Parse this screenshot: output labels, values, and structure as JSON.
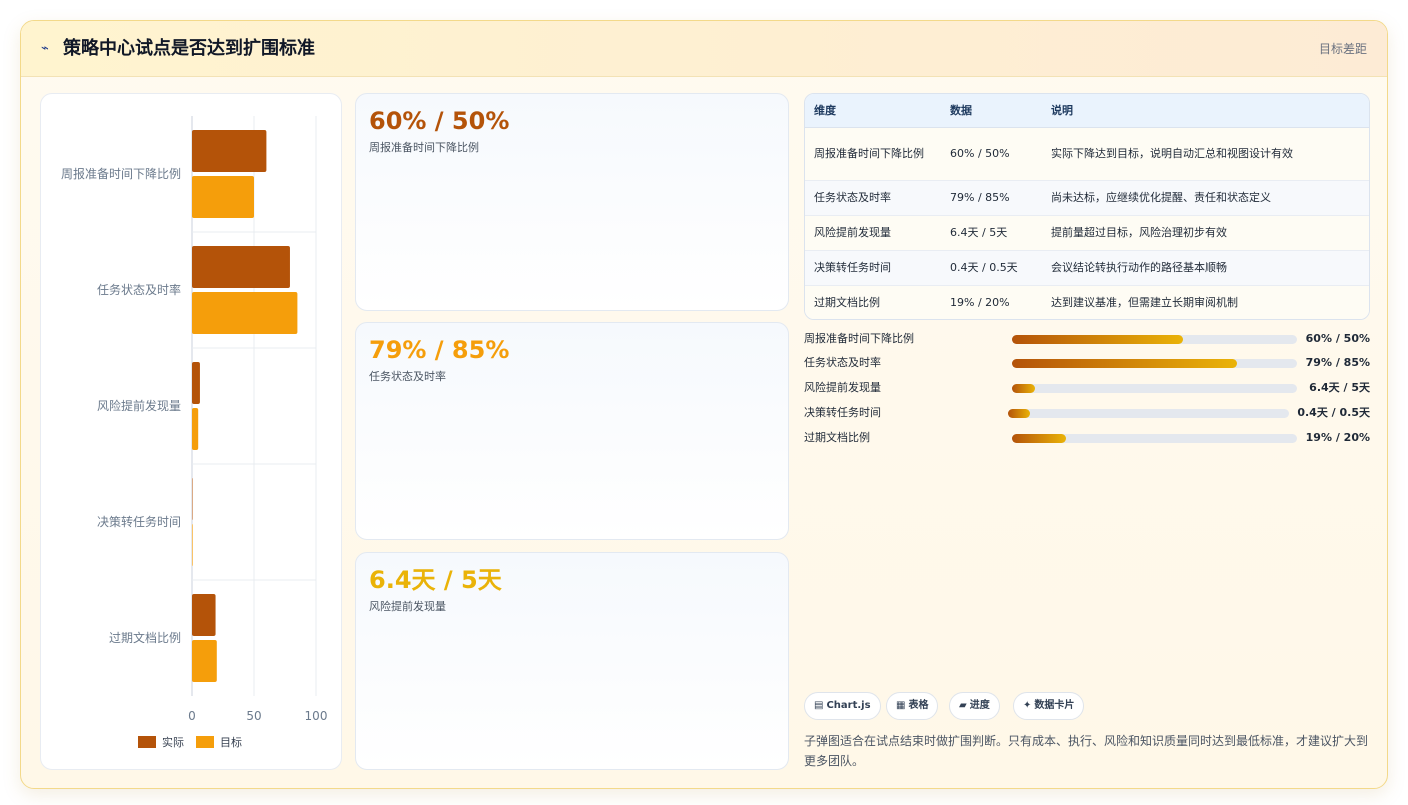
{
  "header": {
    "icon": "chart-line-icon",
    "title": "策略中心试点是否达到扩围标准",
    "badge": "目标差距"
  },
  "chart_data": {
    "type": "bar",
    "orientation": "horizontal",
    "categories": [
      "周报准备时间下降比例",
      "任务状态及时率",
      "风险提前发现量",
      "决策转任务时间",
      "过期文档比例"
    ],
    "series": [
      {
        "name": "实际",
        "values": [
          60,
          79,
          6.4,
          0.4,
          19
        ],
        "color": "#b45309"
      },
      {
        "name": "目标",
        "values": [
          50,
          85,
          5,
          0.5,
          20
        ],
        "color": "#f59e0b"
      }
    ],
    "xlim": [
      0,
      100
    ],
    "xticks": [
      "0",
      "50",
      "100"
    ],
    "grid": true,
    "legend": "bottom"
  },
  "kpis": [
    {
      "value": "60% / 50%",
      "label": "周报准备时间下降比例",
      "color": "#b45309"
    },
    {
      "value": "79% / 85%",
      "label": "任务状态及时率",
      "color": "#f59e0b"
    },
    {
      "value": "6.4天 / 5天",
      "label": "风险提前发现量",
      "color": "#eab308"
    }
  ],
  "table": {
    "headers": [
      "维度",
      "数据",
      "说明"
    ],
    "rows": [
      [
        "周报准备时间下降比例",
        "60% / 50%",
        "实际下降达到目标，说明自动汇总和视图设计有效"
      ],
      [
        "任务状态及时率",
        "79% / 85%",
        "尚未达标，应继续优化提醒、责任和状态定义"
      ],
      [
        "风险提前发现量",
        "6.4天 / 5天",
        "提前量超过目标，风险治理初步有效"
      ],
      [
        "决策转任务时间",
        "0.4天 / 0.5天",
        "会议结论转执行动作的路径基本顺畅"
      ],
      [
        "过期文档比例",
        "19% / 20%",
        "达到建议基准，但需建立长期审阅机制"
      ]
    ]
  },
  "progress": [
    {
      "label": "周报准备时间下降比例",
      "value": "60% / 50%",
      "fill": 0.6
    },
    {
      "label": "任务状态及时率",
      "value": "79% / 85%",
      "fill": 0.79
    },
    {
      "label": "风险提前发现量",
      "value": "6.4天 / 5天",
      "fill": 0.08
    },
    {
      "label": "决策转任务时间",
      "value": "0.4天 / 0.5天",
      "fill": 0.08
    },
    {
      "label": "过期文档比例",
      "value": "19% / 20%",
      "fill": 0.19
    }
  ],
  "chips": [
    {
      "icon": "▤",
      "label": "Chart.js"
    },
    {
      "icon": "▦",
      "label": "表格"
    },
    {
      "icon": "▰",
      "label": "进度"
    },
    {
      "icon": "✦",
      "label": "数据卡片"
    }
  ],
  "note": "子弹图适合在试点结束时做扩围判断。只有成本、执行、风险和知识质量同时达到最低标准，才建议扩大到更多团队。"
}
